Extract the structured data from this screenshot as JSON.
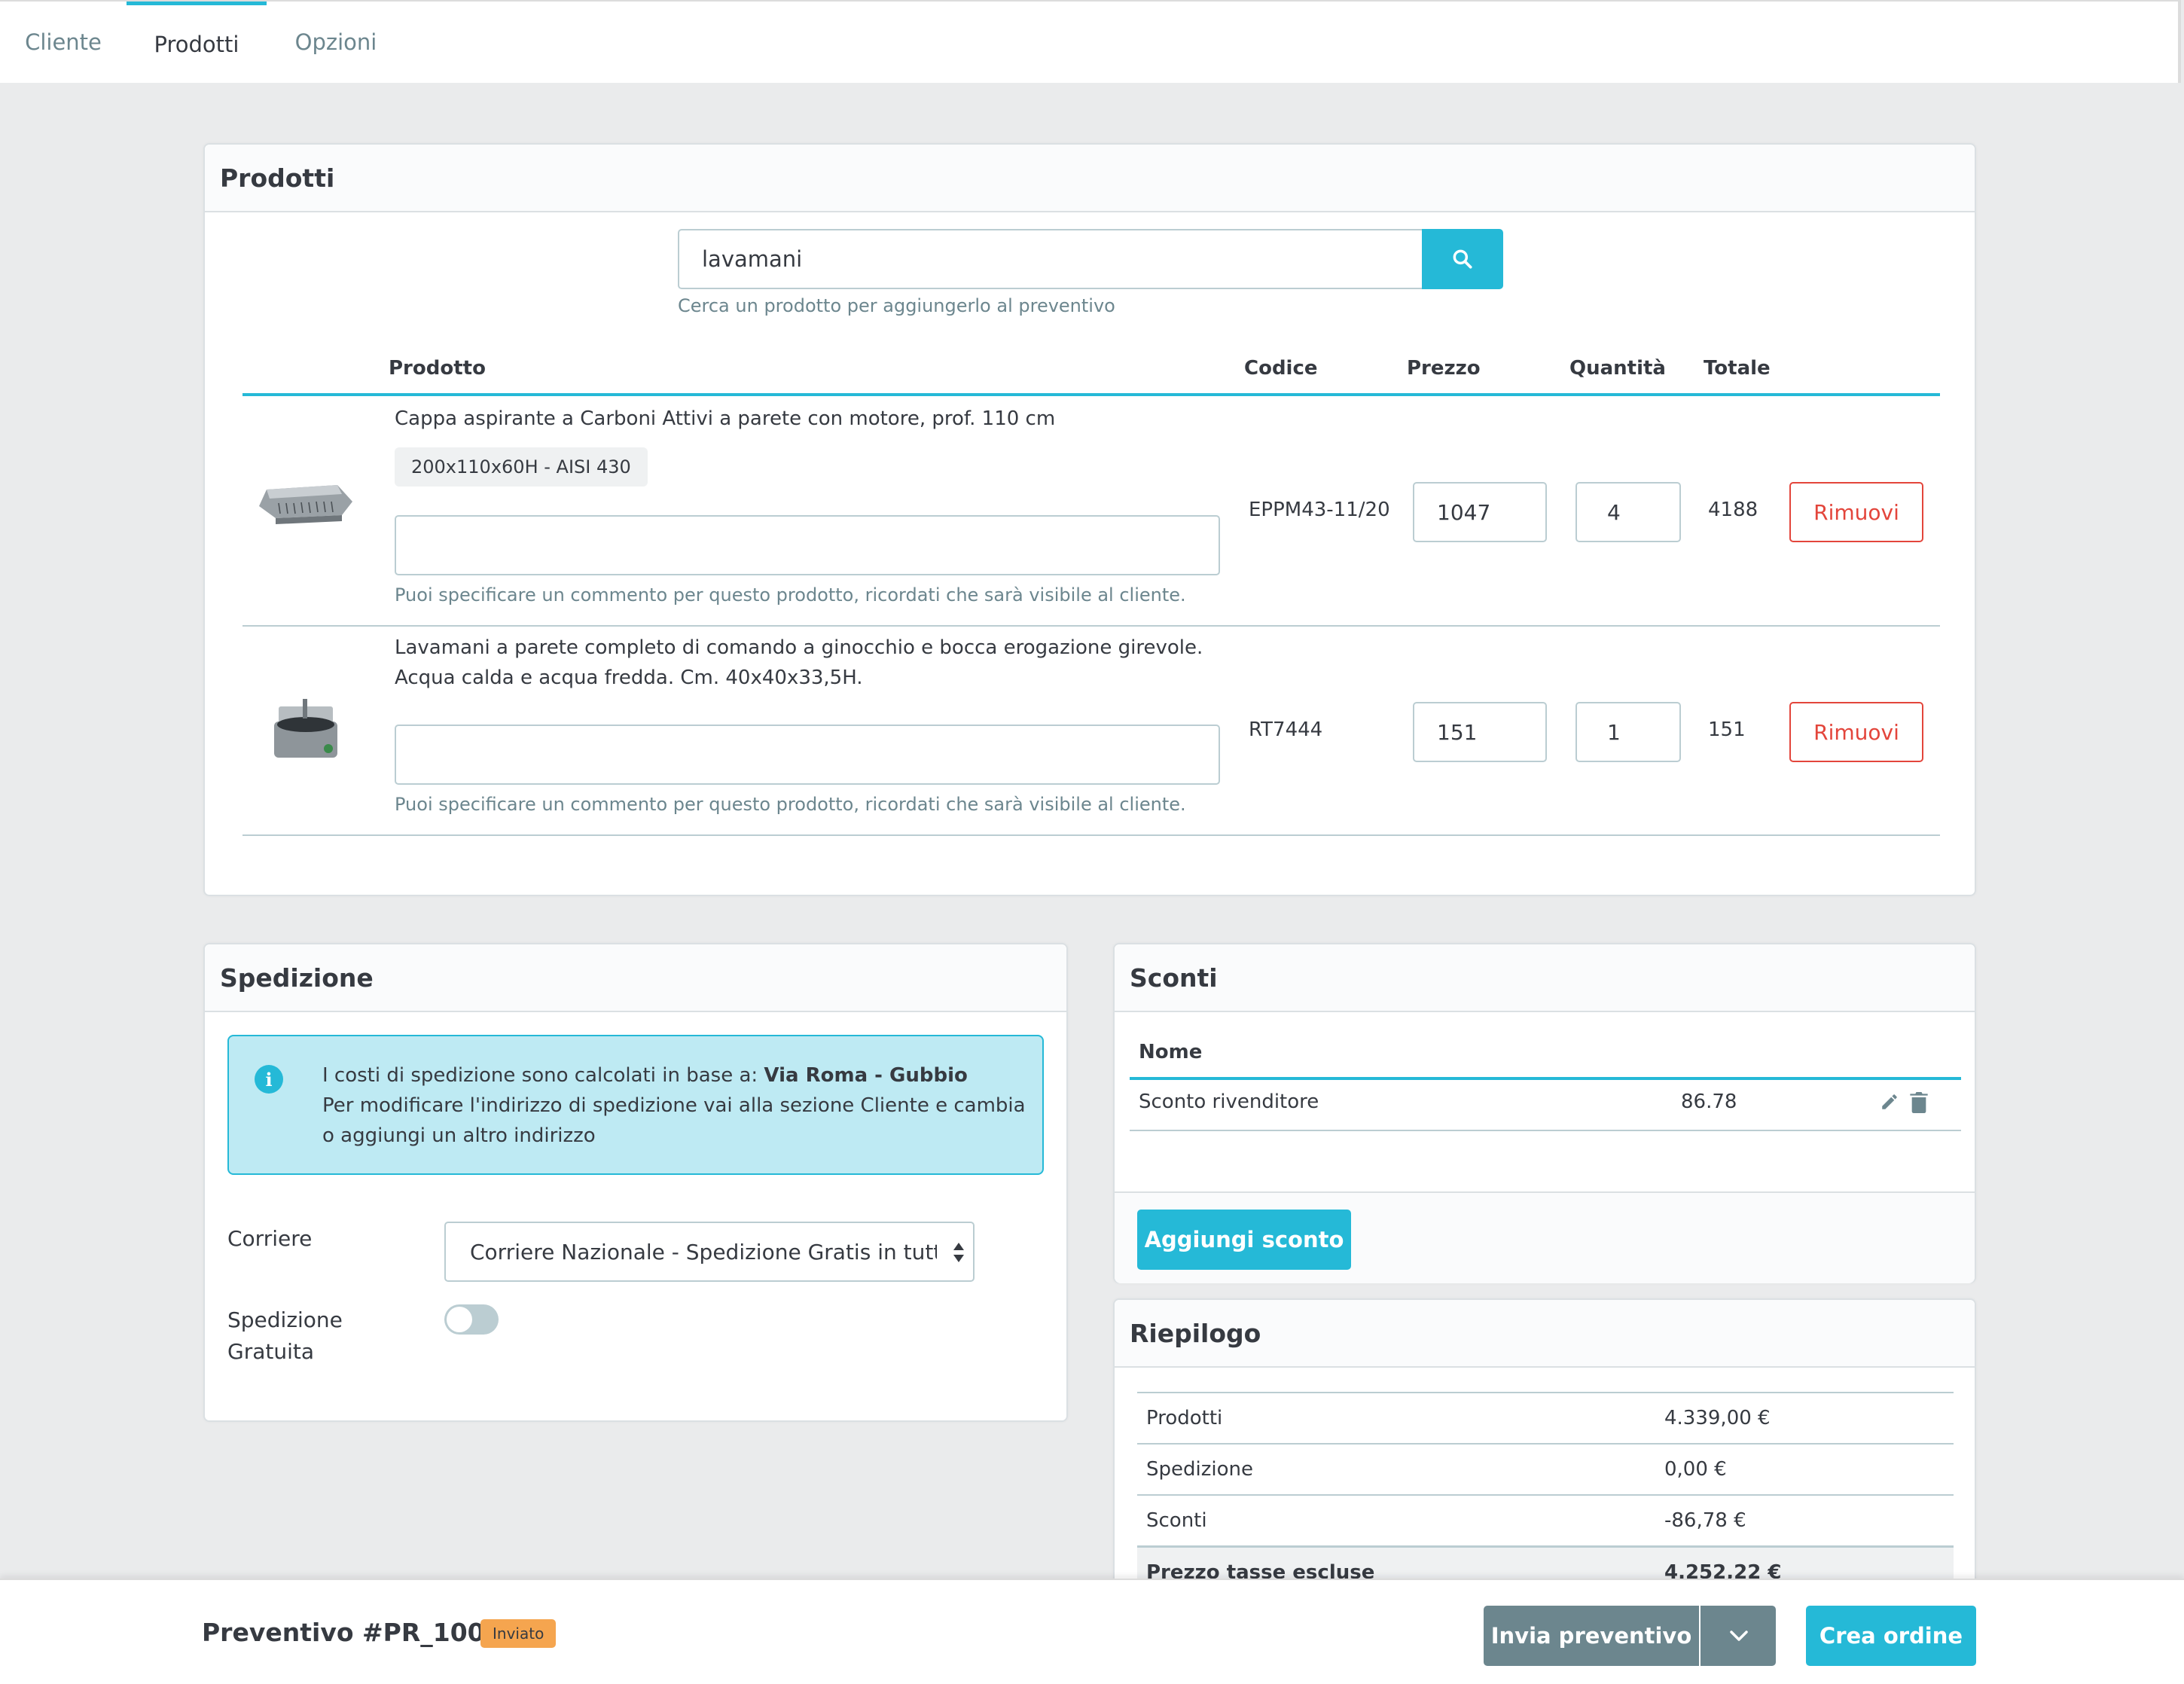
{
  "tabs": [
    {
      "label": "Cliente"
    },
    {
      "label": "Prodotti"
    },
    {
      "label": "Opzioni"
    }
  ],
  "products": {
    "title": "Prodotti",
    "search": {
      "value": "lavamani",
      "help": "Cerca un prodotto per aggiungerlo al preventivo"
    },
    "columns": {
      "product": "Prodotto",
      "code": "Codice",
      "price": "Prezzo",
      "quantity": "Quantità",
      "total": "Totale"
    },
    "rows": [
      {
        "name": "Cappa aspirante a Carboni Attivi a parete con motore, prof. 110 cm",
        "variant": "200x110x60H - AISI 430",
        "comment_help": "Puoi specificare un commento per questo prodotto, ricordati che sarà visibile al cliente.",
        "code": "EPPM43-11/20",
        "price": "1047",
        "quantity": "4",
        "total": "4188",
        "remove_label": "Rimuovi"
      },
      {
        "name": "Lavamani a parete completo di comando a ginocchio e bocca erogazione girevole. Acqua calda e acqua fredda. Cm. 40x40x33,5H.",
        "comment_help": "Puoi specificare un commento per questo prodotto, ricordati che sarà visibile al cliente.",
        "code": "RT7444",
        "price": "151",
        "quantity": "1",
        "total": "151",
        "remove_label": "Rimuovi"
      }
    ]
  },
  "shipping": {
    "title": "Spedizione",
    "alert_line1": "I costi di spedizione sono calcolati in base a: ",
    "alert_address": "Via Roma - Gubbio",
    "alert_line2": "Per modificare l'indirizzo di spedizione vai alla sezione Cliente e cambia o aggiungi un altro indirizzo",
    "carrier_label": "Corriere",
    "carrier_value": "Corriere Nazionale - Spedizione Gratis in tutta Italia",
    "free_label": "Spedizione Gratuita",
    "free_enabled": false
  },
  "discounts": {
    "title": "Sconti",
    "column_name": "Nome",
    "rows": [
      {
        "name": "Sconto rivenditore",
        "value": "86.78"
      }
    ],
    "add_label": "Aggiungi sconto"
  },
  "summary": {
    "title": "Riepilogo",
    "rows": [
      {
        "label": "Prodotti",
        "value": "4.339,00 €"
      },
      {
        "label": "Spedizione",
        "value": "0,00 €"
      },
      {
        "label": "Sconti",
        "value": "-86,78 €"
      },
      {
        "label": "Prezzo tasse escluse",
        "value": "4.252,22 €"
      }
    ]
  },
  "footer": {
    "quote_title": "Preventivo #PR_1002",
    "status": "Inviato",
    "send_label": "Invia preventivo",
    "create_order_label": "Crea ordine"
  },
  "colors": {
    "accent": "#25b9d7",
    "danger": "#e3453b",
    "secondary": "#6c868e",
    "status": "#f5a54f"
  }
}
